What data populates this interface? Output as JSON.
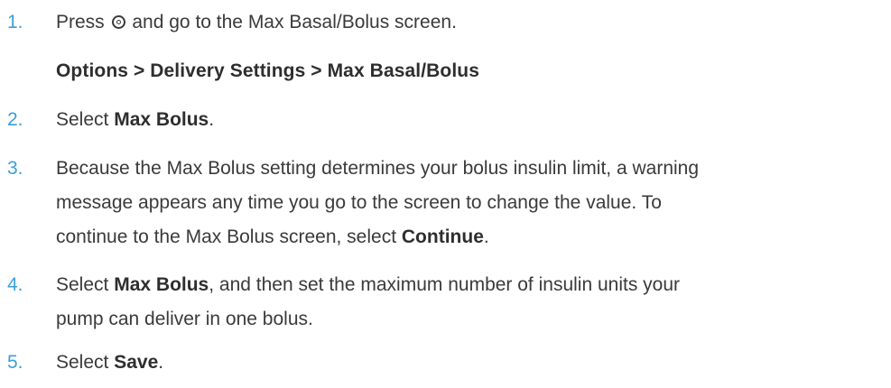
{
  "steps": [
    {
      "num": "1.",
      "pre": "Press",
      "icon": "home-button-icon",
      "post": "and go to the Max Basal/Bolus screen."
    },
    {
      "num": "2.",
      "pre": "Select",
      "bold": "Max Bolus",
      "post": "."
    },
    {
      "num": "3.",
      "line1": "Because the Max Bolus setting determines your bolus insulin limit, a warning",
      "line2": "message appears any time you go to the screen to change the value. To",
      "line3_pre": "continue to the Max Bolus screen, select",
      "line3_bold": "Continue",
      "line3_post": "."
    },
    {
      "num": "4.",
      "pre": "Select",
      "bold": "Max Bolus",
      "line1_post": ", and then set the maximum number of insulin units your",
      "line2": "pump can deliver in one bolus."
    },
    {
      "num": "5.",
      "pre": "Select",
      "bold": "Save",
      "post": "."
    }
  ],
  "menu_path": "Options > Delivery Settings > Max Basal/Bolus",
  "colors": {
    "step_number": "#3aa0d8",
    "text": "#3a3a3a"
  }
}
